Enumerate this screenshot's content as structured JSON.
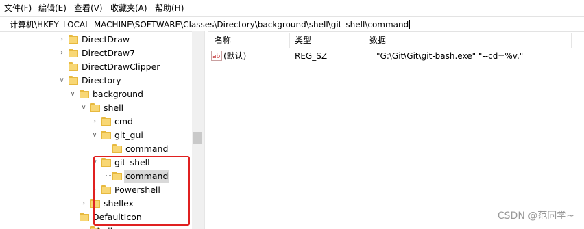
{
  "menu": {
    "file": "文件(F)",
    "edit": "编辑(E)",
    "view": "查看(V)",
    "favorites": "收藏夹(A)",
    "help": "帮助(H)"
  },
  "address": "计算机\\HKEY_LOCAL_MACHINE\\SOFTWARE\\Classes\\Directory\\background\\shell\\git_shell\\command",
  "tree": {
    "directdraw": "DirectDraw",
    "directdraw7": "DirectDraw7",
    "directdrawclipper": "DirectDrawClipper",
    "directory": "Directory",
    "background": "background",
    "shell": "shell",
    "cmd": "cmd",
    "git_gui": "git_gui",
    "git_gui_command": "command",
    "git_shell": "git_shell",
    "git_shell_command": "command",
    "powershell": "Powershell",
    "shellex": "shellex",
    "defaulticon": "DefaultIcon",
    "shell_partial": "shell"
  },
  "list": {
    "headers": {
      "name": "名称",
      "type": "类型",
      "data": "数据"
    },
    "rows": [
      {
        "name": "(默认)",
        "type": "REG_SZ",
        "data": "\"G:\\Git\\Git\\git-bash.exe\" \"--cd=%v.\""
      }
    ]
  },
  "watermark": "CSDN @范同学~",
  "colors": {
    "highlight": "#e02020",
    "folder": "#f8d775",
    "selected": "#d9d9d9"
  }
}
